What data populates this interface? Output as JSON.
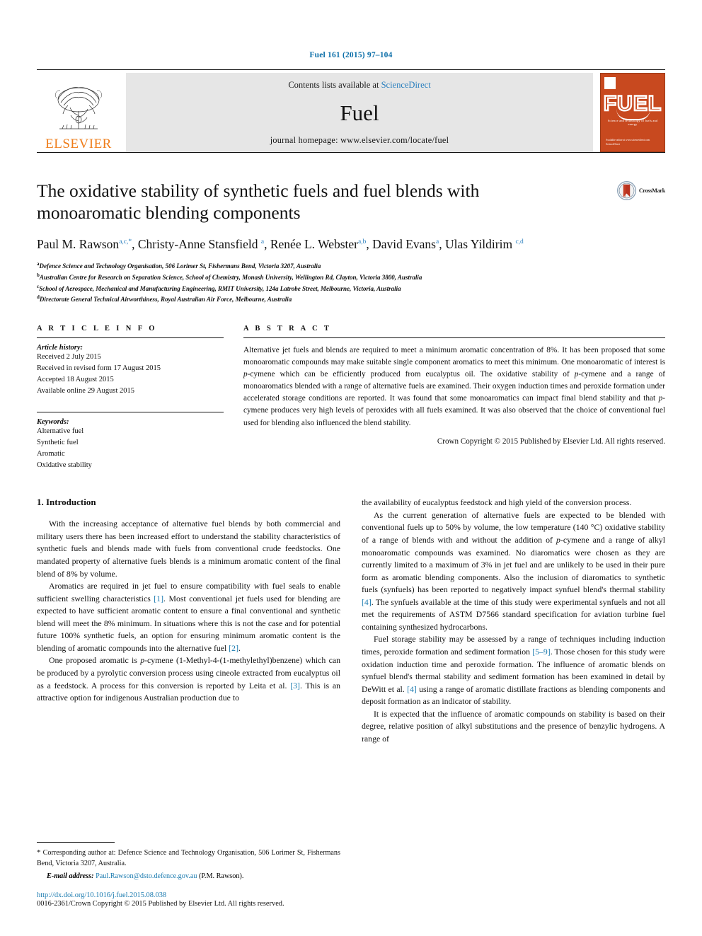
{
  "running_head": "Fuel 161 (2015) 97–104",
  "masthead": {
    "publisher_name": "ELSEVIER",
    "contents_prefix": "Contents lists available at ",
    "contents_link": "ScienceDirect",
    "journal_name": "Fuel",
    "homepage": "journal homepage: www.elsevier.com/locate/fuel",
    "cover": {
      "title": "FUEL",
      "subtitle": "Science and technology of fuels and energy",
      "bottom_text": "Available online at www.sciencedirect.com\nScienceDirect"
    }
  },
  "title": "The oxidative stability of synthetic fuels and fuel blends with monoaromatic blending components",
  "crossmark_label": "CrossMark",
  "authors": [
    {
      "name": "Paul M. Rawson",
      "sup": "a,c,*"
    },
    {
      "name": "Christy-Anne Stansfield",
      "sup": "a"
    },
    {
      "name": "Renée L. Webster",
      "sup": "a,b"
    },
    {
      "name": "David Evans",
      "sup": "a"
    },
    {
      "name": "Ulas Yildirim",
      "sup": "c,d"
    }
  ],
  "affiliations": [
    {
      "mark": "a",
      "text": "Defence Science and Technology Organisation, 506 Lorimer St, Fishermans Bend, Victoria 3207, Australia"
    },
    {
      "mark": "b",
      "text": "Australian Centre for Research on Separation Science, School of Chemistry, Monash University, Wellington Rd, Clayton, Victoria 3800, Australia"
    },
    {
      "mark": "c",
      "text": "School of Aerospace, Mechanical and Manufacturing Engineering, RMIT University, 124a Latrobe Street, Melbourne, Victoria, Australia"
    },
    {
      "mark": "d",
      "text": "Directorate General Technical Airworthiness, Royal Australian Air Force, Melbourne, Australia"
    }
  ],
  "article_info": {
    "heading": "A R T I C L E   I N F O",
    "history_label": "Article history:",
    "history": [
      "Received 2 July 2015",
      "Received in revised form 17 August 2015",
      "Accepted 18 August 2015",
      "Available online 29 August 2015"
    ],
    "keywords_label": "Keywords:",
    "keywords": [
      "Alternative fuel",
      "Synthetic fuel",
      "Aromatic",
      "Oxidative stability"
    ]
  },
  "abstract": {
    "heading": "A B S T R A C T",
    "part1": "Alternative jet fuels and blends are required to meet a minimum aromatic concentration of 8%. It has been proposed that some monoaromatic compounds may make suitable single component aromatics to meet this minimum. One monoaromatic of interest is ",
    "italic1": "p",
    "part2": "-cymene which can be efficiently produced from eucalyptus oil. The oxidative stability of ",
    "italic2": "p",
    "part3": "-cymene and a range of monoaromatics blended with a range of alternative fuels are examined. Their oxygen induction times and peroxide formation under accelerated storage conditions are reported. It was found that some monoaromatics can impact final blend stability and that ",
    "italic3": "p",
    "part4": "-cymene produces very high levels of peroxides with all fuels examined. It was also observed that the choice of conventional fuel used for blending also influenced the blend stability.",
    "copyright": "Crown Copyright © 2015 Published by Elsevier Ltd. All rights reserved."
  },
  "section_title": "1. Introduction",
  "left_column": {
    "p1": "With the increasing acceptance of alternative fuel blends by both commercial and military users there has been increased effort to understand the stability characteristics of synthetic fuels and blends made with fuels from conventional crude feedstocks. One mandated property of alternative fuels blends is a minimum aromatic content of the final blend of 8% by volume.",
    "p2_a": "Aromatics are required in jet fuel to ensure compatibility with fuel seals to enable sufficient swelling characteristics ",
    "p2_ref1": "[1]",
    "p2_b": ". Most conventional jet fuels used for blending are expected to have sufficient aromatic content to ensure a final conventional and synthetic blend will meet the 8% minimum. In situations where this is not the case and for potential future 100% synthetic fuels, an option for ensuring minimum aromatic content is the blending of aromatic compounds into the alternative fuel ",
    "p2_ref2": "[2]",
    "p2_c": ".",
    "p3_a": "One proposed aromatic is ",
    "p3_ital": "p",
    "p3_b": "-cymene (1-Methyl-4-(1-methylethyl)benzene) which can be produced by a pyrolytic conversion process using cineole extracted from eucalyptus oil as a feedstock. A process for this conversion is reported by Leita et al. ",
    "p3_ref": "[3]",
    "p3_c": ". This is an attractive option for indigenous Australian production due to"
  },
  "right_column": {
    "p1": "the availability of eucalyptus feedstock and high yield of the conversion process.",
    "p2_a": "As the current generation of alternative fuels are expected to be blended with conventional fuels up to 50% by volume, the low temperature (140 °C) oxidative stability of a range of blends with and without the addition of ",
    "p2_ital": "p",
    "p2_b": "-cymene and a range of alkyl monoaromatic compounds was examined. No diaromatics were chosen as they are currently limited to a maximum of 3% in jet fuel and are unlikely to be used in their pure form as aromatic blending components. Also the inclusion of diaromatics to synthetic fuels (synfuels) has been reported to negatively impact synfuel blend's thermal stability ",
    "p2_ref": "[4]",
    "p2_c": ". The synfuels available at the time of this study were experimental synfuels and not all met the requirements of ASTM D7566 standard specification for aviation turbine fuel containing synthesized hydrocarbons.",
    "p3_a": "Fuel storage stability may be assessed by a range of techniques including induction times, peroxide formation and sediment formation ",
    "p3_ref1": "[5–9]",
    "p3_b": ". Those chosen for this study were oxidation induction time and peroxide formation. The influence of aromatic blends on synfuel blend's thermal stability and sediment formation has been examined in detail by DeWitt et al. ",
    "p3_ref2": "[4]",
    "p3_c": " using a range of aromatic distillate fractions as blending components and deposit formation as an indicator of stability.",
    "p4": "It is expected that the influence of aromatic compounds on stability is based on their degree, relative position of alkyl substitutions and the presence of benzylic hydrogens. A range of"
  },
  "footer": {
    "corresponding_star": "*",
    "corresponding": " Corresponding author at: Defence Science and Technology Organisation, 506 Lorimer St, Fishermans Bend, Victoria 3207, Australia.",
    "email_label": "E-mail address:",
    "email": "Paul.Rawson@dsto.defence.gov.au",
    "email_owner": "(P.M. Rawson).",
    "doi": "http://dx.doi.org/10.1016/j.fuel.2015.08.038",
    "issn_copyright": "0016-2361/Crown Copyright © 2015 Published by Elsevier Ltd. All rights reserved."
  },
  "colors": {
    "link": "#1a7aaf",
    "running_head": "#0b6ea8",
    "elsevier_orange": "#ef7d1a",
    "cover_orange": "#c8491f"
  }
}
